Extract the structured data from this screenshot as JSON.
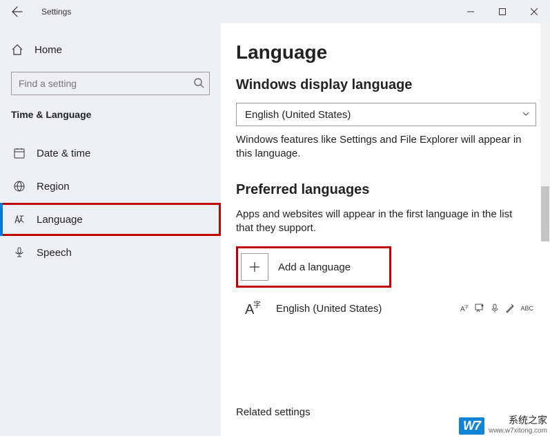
{
  "titlebar": {
    "title": "Settings"
  },
  "sidebar": {
    "home": "Home",
    "search_placeholder": "Find a setting",
    "section": "Time & Language",
    "items": [
      {
        "label": "Date & time"
      },
      {
        "label": "Region"
      },
      {
        "label": "Language"
      },
      {
        "label": "Speech"
      }
    ]
  },
  "main": {
    "title": "Language",
    "display_heading": "Windows display language",
    "display_value": "English (United States)",
    "display_help": "Windows features like Settings and File Explorer will appear in this language.",
    "preferred_heading": "Preferred languages",
    "preferred_help": "Apps and websites will appear in the first language in the list that they support.",
    "add_label": "Add a language",
    "lang0": "English (United States)",
    "abc_label": "ABC",
    "related": "Related settings"
  },
  "watermark": {
    "logo": "W7",
    "text": "系统之家",
    "url": "www.w7xitong.com"
  }
}
